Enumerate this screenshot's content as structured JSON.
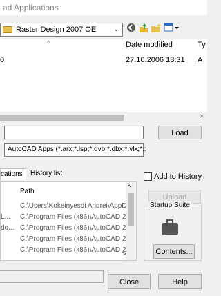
{
  "window": {
    "title": "ad Applications"
  },
  "lookin": {
    "value": "Raster Design 2007 OE"
  },
  "toolbar": {
    "back_icon": "back-icon",
    "up_folder_icon": "up-folder-icon",
    "new_folder_icon": "new-folder-icon",
    "view_menu_icon": "view-menu-icon"
  },
  "filelist": {
    "columns": {
      "date": "Date modified",
      "type": "Ty"
    },
    "rows": [
      {
        "name": "0",
        "date": "27.10.2006 18:31",
        "type": "A"
      }
    ]
  },
  "filename": {
    "value": ""
  },
  "load_button": "Load",
  "filetype": {
    "value": "AutoCAD Apps (*.arx;*.lsp;*.dvb;*.dbx;*.vlx;*.:"
  },
  "tabs": [
    {
      "label": "cations",
      "active": true
    },
    {
      "label": "History list",
      "active": false
    }
  ],
  "add_to_history": {
    "label": "Add to History",
    "checked": false
  },
  "applist": {
    "col_path": "Path",
    "rows": [
      {
        "name": "",
        "path": "C:\\Users\\Kokeinyesdi Andrei\\AppD."
      },
      {
        "name": "L...",
        "path": "C:\\Program Files (x86)\\AutoCAD 20."
      },
      {
        "name": "do...",
        "path": "C:\\Program Files (x86)\\AutoCAD 20."
      },
      {
        "name": "",
        "path": "C:\\Program Files (x86)\\AutoCAD 20."
      },
      {
        "name": "",
        "path": "C:\\Program Files (x86)\\AutoCAD 20."
      }
    ]
  },
  "unload_button": "Unload",
  "startup_suite": {
    "label": "Startup Suite",
    "contents_button": "Contents..."
  },
  "close_button": "Close",
  "help_button": "Help"
}
